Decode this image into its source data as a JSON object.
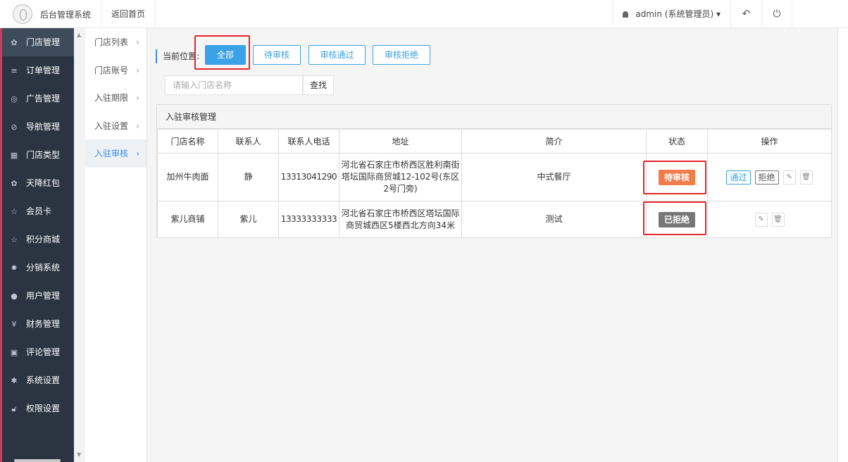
{
  "app": {
    "title": "后台管理系统",
    "home_link": "返回首页"
  },
  "topbar": {
    "user_label": "admin (系统管理员)",
    "dropdown_glyph": "▾",
    "back_icon": "↶",
    "power_icon": "⏻"
  },
  "sidebar": {
    "items": [
      {
        "label": "门店管理",
        "icon": "stores-icon",
        "glyph": "✿"
      },
      {
        "label": "订单管理",
        "icon": "list-icon",
        "glyph": "≡"
      },
      {
        "label": "广告管理",
        "icon": "lifebuoy-icon",
        "glyph": "◎"
      },
      {
        "label": "导航管理",
        "icon": "compass-icon",
        "glyph": "⊘"
      },
      {
        "label": "门店类型",
        "icon": "bank-icon",
        "glyph": "▦"
      },
      {
        "label": "天降红包",
        "icon": "redpacket-icon",
        "glyph": "✿"
      },
      {
        "label": "会员卡",
        "icon": "star-icon",
        "glyph": "☆"
      },
      {
        "label": "积分商城",
        "icon": "star-icon",
        "glyph": "☆"
      },
      {
        "label": "分销系统",
        "icon": "users-icon",
        "glyph": "✸"
      },
      {
        "label": "用户管理",
        "icon": "user-icon",
        "glyph": "●"
      },
      {
        "label": "财务管理",
        "icon": "yen-icon",
        "glyph": "¥"
      },
      {
        "label": "评论管理",
        "icon": "money-icon",
        "glyph": "▣"
      },
      {
        "label": "系统设置",
        "icon": "gear-icon",
        "glyph": "✱"
      },
      {
        "label": "权限设置",
        "icon": "lock-icon",
        "glyph": "🔓︎"
      }
    ]
  },
  "subnav": {
    "items": [
      {
        "label": "门店列表"
      },
      {
        "label": "门店账号"
      },
      {
        "label": "入驻期限"
      },
      {
        "label": "入驻设置"
      },
      {
        "label": "入驻审核"
      }
    ],
    "chevron": "›"
  },
  "breadcrumb": {
    "label": "当前位置:"
  },
  "filters": {
    "all": "全部",
    "pending": "待审核",
    "approved": "审核通过",
    "rejected": "审核拒绝"
  },
  "search": {
    "placeholder": "请输入门店名称",
    "button": "查找"
  },
  "panel": {
    "title": "入驻审核管理",
    "columns": [
      "门店名称",
      "联系人",
      "联系人电话",
      "地址",
      "简介",
      "状态",
      "操作"
    ],
    "rows": [
      {
        "name": "加州牛肉面",
        "contact": "静",
        "phone": "13313041290",
        "address": "河北省石家庄市桥西区胜利南街塔坛国际商贸城12-102号(东区2号门旁)",
        "intro": "中式餐厅",
        "status": "待审核",
        "status_color": "#f37b4a",
        "approve": "通过",
        "reject": "拒绝"
      },
      {
        "name": "紫儿商铺",
        "contact": "紫儿",
        "phone": "13333333333",
        "address": "河北省石家庄市桥西区塔坛国际商贸城西区5楼西北方向34米",
        "intro": "测试",
        "status": "已拒绝",
        "status_color": "#777777"
      }
    ],
    "edit_icon": "✎",
    "trash_icon": "🗑︎"
  },
  "colors": {
    "accent": "#3aa2e6",
    "sidebar_bg": "#2b3541",
    "highlight": "#e5262c"
  }
}
